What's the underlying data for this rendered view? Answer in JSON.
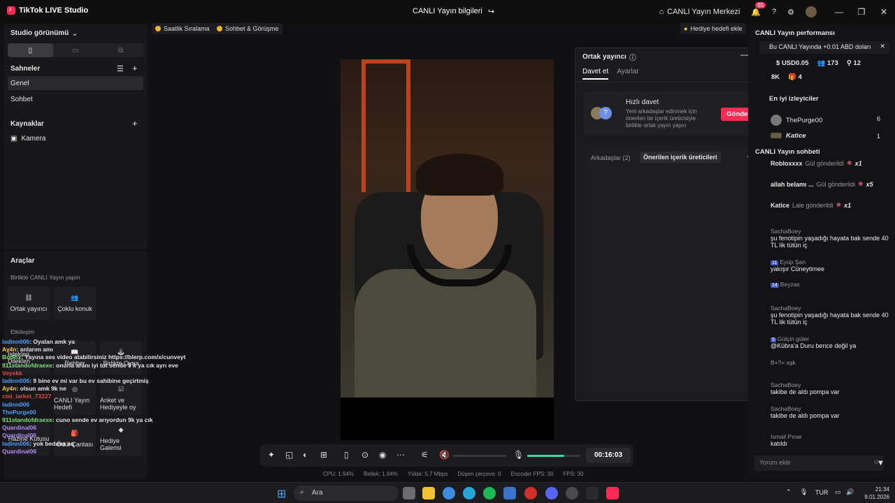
{
  "app": {
    "title": "TikTok LIVE Studio",
    "live_info": "CANLI Yayın bilgileri",
    "live_center": "CANLI Yayın Merkezi",
    "notif_count": "65"
  },
  "left": {
    "studio_view": "Studio görünümü",
    "scenes_title": "Sahneler",
    "scenes": [
      "Genel",
      "Sohbet"
    ],
    "sources_title": "Kaynaklar",
    "sources": [
      "Kamera"
    ],
    "tools_title": "Araçlar",
    "together_title": "Birlikte CANLI Yayın yapın",
    "cohost_tile": "Ortak yayıncı",
    "multi_guest_tile": "Çoklu konuk",
    "interaction_title": "Etkileşim",
    "tiles": [
      "Rehber",
      "Birlikte Oyna",
      "İstekleri Dilekleri",
      "CANLI Yayın Hedefi",
      "Anket ve Hediyeyle oy",
      "Hazine Kutusu",
      "Ödül Çantası",
      "Hediye Galerisi"
    ]
  },
  "chat_overlay": [
    {
      "user": "ladinn006",
      "text": ": Oyalan amk ya",
      "cls": "u1"
    },
    {
      "user": "Ay4n",
      "text": ": anlarım amı",
      "cls": "u2"
    },
    {
      "user": "BotRix",
      "text": ": Yayına ses video atabilirsiniz https://blerp.com/x/cunveyt",
      "cls": "u3"
    },
    {
      "user": "911standofdraexe",
      "text": ": onurla aranı iyi tut sende 9 k ya cık ayrı eve",
      "cls": "u3"
    },
    {
      "user": "Veyskk",
      "text": "",
      "cls": "u4"
    },
    {
      "user": "ladinn006",
      "text": ": 9 bine ev mi var bu ev sahibine geçirtmiş",
      "cls": "u1"
    },
    {
      "user": "Ay4n",
      "text": ": olsun amk 9k ne",
      "cls": "u2"
    },
    {
      "user": "cmi_iarket_73227",
      "text": "",
      "cls": "u4"
    },
    {
      "user": "ladinn006",
      "text": "",
      "cls": "u1"
    },
    {
      "user": "ThePurge00",
      "text": "",
      "cls": "u1"
    },
    {
      "user": "911standofdraexe",
      "text": ": cuno sende ev arıyordun 9k ya cık",
      "cls": "u3"
    },
    {
      "user": "Quardinal06",
      "text": "",
      "cls": "u5"
    },
    {
      "user": "Quardinal06",
      "text": "",
      "cls": "u5"
    },
    {
      "user": "ladinn006",
      "text": ": yok bedava aq",
      "cls": "u1"
    },
    {
      "user": "Quardinal06",
      "text": "",
      "cls": "u5"
    }
  ],
  "chips": {
    "rank": "Saatlik Sıralama",
    "chat": "Sohbet & Görüşme",
    "gift_goal": "Hediye hedefi ekle"
  },
  "cohost": {
    "title": "Ortak yayıncı",
    "tab_invite": "Davet et",
    "tab_settings": "Ayarlar",
    "quick_title": "Hızlı davet",
    "quick_desc": "Yeni arkadaşlar edinmek için önerilen bir içerik üreticisiyle birlikte ortak yayın yapın",
    "send": "Gönder",
    "friends_tab": "Arkadaşlar (2)",
    "suggested_tab": "Önerilen içerik üreticileri"
  },
  "right": {
    "perf_title": "CANLI Yayın performansı",
    "banner": "Bu CANLI Yayında +0.01 ABD doları",
    "usd": "USD0.05",
    "viewers": "173",
    "shares": "12",
    "likes": "8K",
    "gifts": "4",
    "top_viewers_title": "En iyi izleyiciler",
    "top1": "ThePurge00",
    "top1_score": "6",
    "top2": "Katice",
    "top2_score": "1",
    "chat_title": "CANLI Yayın sohbeti",
    "gifts_list": [
      {
        "user": "Robloxxxx",
        "text": "Gül gönderildi",
        "count": "x1"
      },
      {
        "user": "allah belamı ...",
        "text": "Gül gönderildi",
        "count": "x5"
      },
      {
        "user": "Katice",
        "text": "Lale gönderildi",
        "count": "x1"
      }
    ],
    "messages": [
      {
        "name": "SachaBoey",
        "level": "",
        "text": "şu fenotipin yaşadığı hayata bak sende 40 TL lik tütün iç"
      },
      {
        "name": "Eyüp Şan",
        "level": "11",
        "text": "yakışır Cüneytimee"
      },
      {
        "name": "Beyzas",
        "level": "14",
        "text": ""
      },
      {
        "name": "SachaBoey",
        "level": "",
        "text": "şu fenotipin yaşadığı hayata bak sende 40 TL lik tütün iç"
      },
      {
        "name": "Gülçin güler",
        "level": "5",
        "text": "@Kübra'a Duru bence değil ya"
      },
      {
        "name": "B+?= aşk",
        "level": "",
        "text": ""
      },
      {
        "name": "SachaBoey",
        "level": "",
        "text": "takibe de aldı pompa var"
      },
      {
        "name": "SachaBoey",
        "level": "",
        "text": "takibe de aldı pompa var"
      },
      {
        "name": "Ismail Pınar",
        "level": "",
        "text": "katıldı"
      }
    ],
    "comment_placeholder": "Yorum ekle"
  },
  "controls": {
    "timer": "00:16:03",
    "mic_level": 0.7
  },
  "stats": {
    "cpu": "CPU: 1.94%",
    "memory": "Bellek: 1.94%",
    "upload": "Yükle: 5.7 Mbps",
    "dropped": "Düşen çerçeve: 0",
    "encoder_fps": "Encoder FPS: 30",
    "fps": "FPS: 30"
  },
  "taskbar": {
    "search": "Ara",
    "lang": "TUR",
    "time": "21:34",
    "date": "9.01.2026"
  }
}
